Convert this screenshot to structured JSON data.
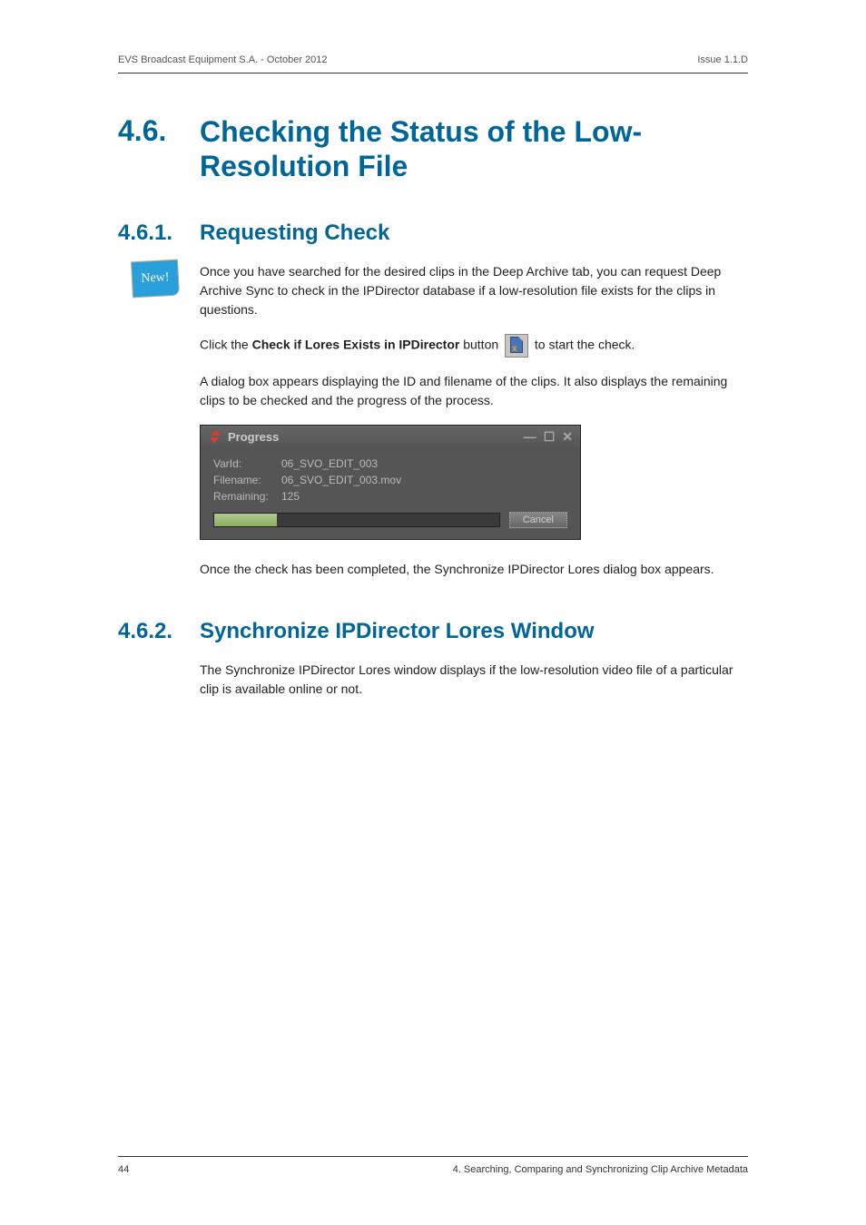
{
  "header": {
    "left": "EVS Broadcast Equipment S.A.  - October 2012",
    "right": "Issue 1.1.D"
  },
  "section": {
    "num": "4.6.",
    "title": "Checking the Status of the Low-Resolution File"
  },
  "sub1": {
    "num": "4.6.1.",
    "title": "Requesting Check",
    "badge": "New!",
    "p1": "Once you have searched for the desired clips in the Deep Archive tab, you can request Deep Archive Sync to check in the IPDirector database if a low-resolution file exists for the clips in questions.",
    "p2_a": "Click the ",
    "p2_b": "Check if Lores Exists in IPDirector",
    "p2_c": " button ",
    "p2_d": " to start the check.",
    "p3": "A dialog box appears displaying the ID and filename of the clips. It also displays the remaining clips to be checked and the progress of the process.",
    "p4": "Once the check has been completed, the Synchronize IPDirector Lores dialog box appears."
  },
  "dialog": {
    "title": "Progress",
    "rows": [
      {
        "label": "VarId:",
        "value": "06_SVO_EDIT_003"
      },
      {
        "label": "Filename:",
        "value": "06_SVO_EDIT_003.mov"
      },
      {
        "label": "Remaining:",
        "value": "125"
      }
    ],
    "cancel": "Cancel"
  },
  "sub2": {
    "num": "4.6.2.",
    "title": "Synchronize IPDirector Lores Window",
    "p1": "The Synchronize IPDirector Lores window displays if the low-resolution video file of a particular clip is available online or not."
  },
  "footer": {
    "left": "44",
    "right": "4. Searching, Comparing and Synchronizing Clip Archive Metadata"
  }
}
